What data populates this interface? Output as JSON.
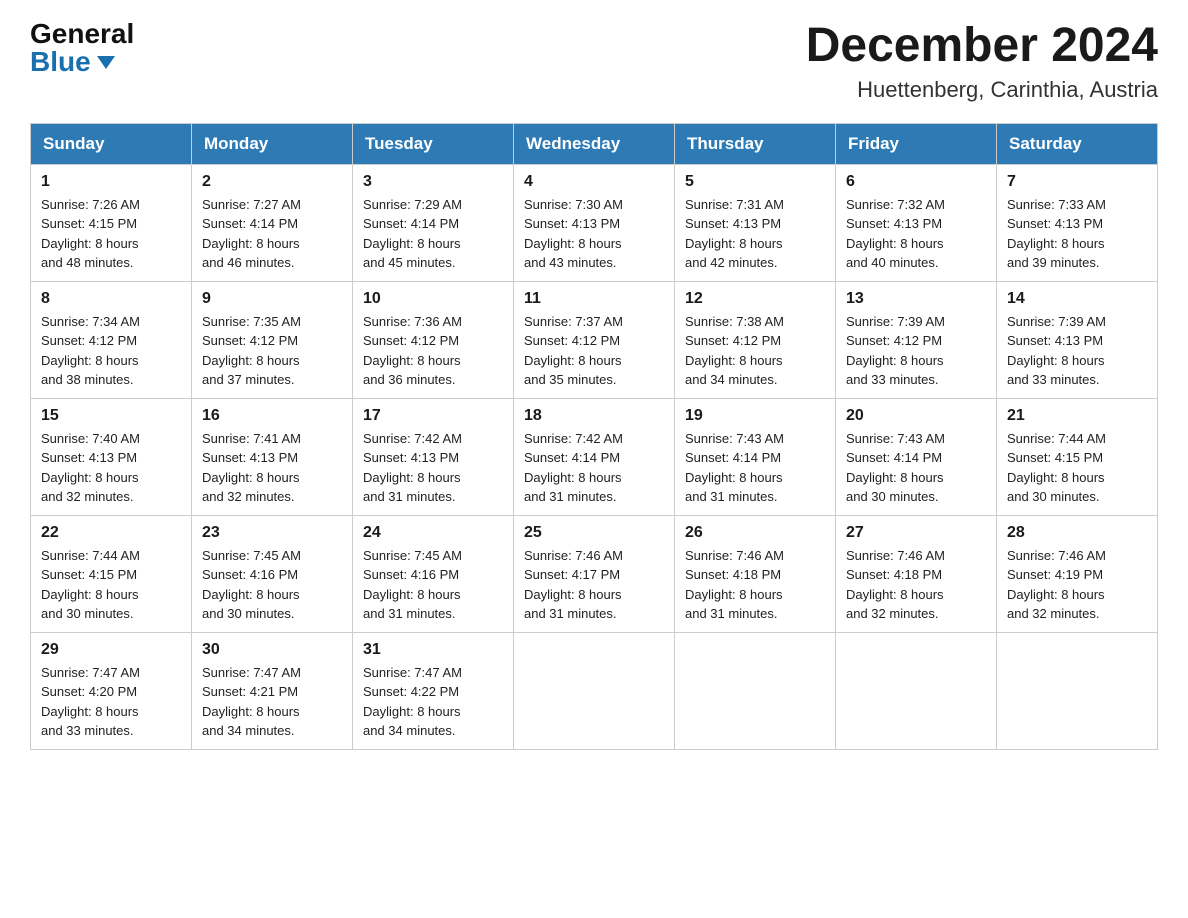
{
  "logo": {
    "line1": "General",
    "line2": "Blue",
    "triangle": "▶"
  },
  "header": {
    "month_year": "December 2024",
    "location": "Huettenberg, Carinthia, Austria"
  },
  "columns": [
    "Sunday",
    "Monday",
    "Tuesday",
    "Wednesday",
    "Thursday",
    "Friday",
    "Saturday"
  ],
  "weeks": [
    [
      {
        "day": "1",
        "sunrise": "7:26 AM",
        "sunset": "4:15 PM",
        "daylight": "8 hours and 48 minutes."
      },
      {
        "day": "2",
        "sunrise": "7:27 AM",
        "sunset": "4:14 PM",
        "daylight": "8 hours and 46 minutes."
      },
      {
        "day": "3",
        "sunrise": "7:29 AM",
        "sunset": "4:14 PM",
        "daylight": "8 hours and 45 minutes."
      },
      {
        "day": "4",
        "sunrise": "7:30 AM",
        "sunset": "4:13 PM",
        "daylight": "8 hours and 43 minutes."
      },
      {
        "day": "5",
        "sunrise": "7:31 AM",
        "sunset": "4:13 PM",
        "daylight": "8 hours and 42 minutes."
      },
      {
        "day": "6",
        "sunrise": "7:32 AM",
        "sunset": "4:13 PM",
        "daylight": "8 hours and 40 minutes."
      },
      {
        "day": "7",
        "sunrise": "7:33 AM",
        "sunset": "4:13 PM",
        "daylight": "8 hours and 39 minutes."
      }
    ],
    [
      {
        "day": "8",
        "sunrise": "7:34 AM",
        "sunset": "4:12 PM",
        "daylight": "8 hours and 38 minutes."
      },
      {
        "day": "9",
        "sunrise": "7:35 AM",
        "sunset": "4:12 PM",
        "daylight": "8 hours and 37 minutes."
      },
      {
        "day": "10",
        "sunrise": "7:36 AM",
        "sunset": "4:12 PM",
        "daylight": "8 hours and 36 minutes."
      },
      {
        "day": "11",
        "sunrise": "7:37 AM",
        "sunset": "4:12 PM",
        "daylight": "8 hours and 35 minutes."
      },
      {
        "day": "12",
        "sunrise": "7:38 AM",
        "sunset": "4:12 PM",
        "daylight": "8 hours and 34 minutes."
      },
      {
        "day": "13",
        "sunrise": "7:39 AM",
        "sunset": "4:12 PM",
        "daylight": "8 hours and 33 minutes."
      },
      {
        "day": "14",
        "sunrise": "7:39 AM",
        "sunset": "4:13 PM",
        "daylight": "8 hours and 33 minutes."
      }
    ],
    [
      {
        "day": "15",
        "sunrise": "7:40 AM",
        "sunset": "4:13 PM",
        "daylight": "8 hours and 32 minutes."
      },
      {
        "day": "16",
        "sunrise": "7:41 AM",
        "sunset": "4:13 PM",
        "daylight": "8 hours and 32 minutes."
      },
      {
        "day": "17",
        "sunrise": "7:42 AM",
        "sunset": "4:13 PM",
        "daylight": "8 hours and 31 minutes."
      },
      {
        "day": "18",
        "sunrise": "7:42 AM",
        "sunset": "4:14 PM",
        "daylight": "8 hours and 31 minutes."
      },
      {
        "day": "19",
        "sunrise": "7:43 AM",
        "sunset": "4:14 PM",
        "daylight": "8 hours and 31 minutes."
      },
      {
        "day": "20",
        "sunrise": "7:43 AM",
        "sunset": "4:14 PM",
        "daylight": "8 hours and 30 minutes."
      },
      {
        "day": "21",
        "sunrise": "7:44 AM",
        "sunset": "4:15 PM",
        "daylight": "8 hours and 30 minutes."
      }
    ],
    [
      {
        "day": "22",
        "sunrise": "7:44 AM",
        "sunset": "4:15 PM",
        "daylight": "8 hours and 30 minutes."
      },
      {
        "day": "23",
        "sunrise": "7:45 AM",
        "sunset": "4:16 PM",
        "daylight": "8 hours and 30 minutes."
      },
      {
        "day": "24",
        "sunrise": "7:45 AM",
        "sunset": "4:16 PM",
        "daylight": "8 hours and 31 minutes."
      },
      {
        "day": "25",
        "sunrise": "7:46 AM",
        "sunset": "4:17 PM",
        "daylight": "8 hours and 31 minutes."
      },
      {
        "day": "26",
        "sunrise": "7:46 AM",
        "sunset": "4:18 PM",
        "daylight": "8 hours and 31 minutes."
      },
      {
        "day": "27",
        "sunrise": "7:46 AM",
        "sunset": "4:18 PM",
        "daylight": "8 hours and 32 minutes."
      },
      {
        "day": "28",
        "sunrise": "7:46 AM",
        "sunset": "4:19 PM",
        "daylight": "8 hours and 32 minutes."
      }
    ],
    [
      {
        "day": "29",
        "sunrise": "7:47 AM",
        "sunset": "4:20 PM",
        "daylight": "8 hours and 33 minutes."
      },
      {
        "day": "30",
        "sunrise": "7:47 AM",
        "sunset": "4:21 PM",
        "daylight": "8 hours and 34 minutes."
      },
      {
        "day": "31",
        "sunrise": "7:47 AM",
        "sunset": "4:22 PM",
        "daylight": "8 hours and 34 minutes."
      },
      null,
      null,
      null,
      null
    ]
  ],
  "labels": {
    "sunrise": "Sunrise:",
    "sunset": "Sunset:",
    "daylight": "Daylight:"
  }
}
